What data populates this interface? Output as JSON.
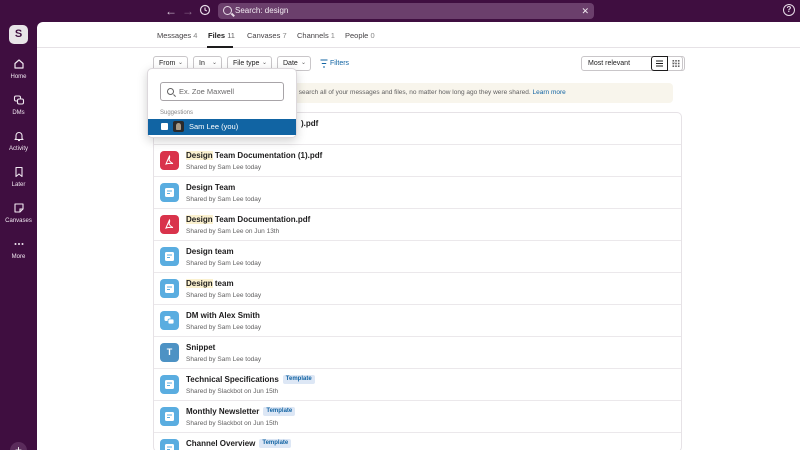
{
  "search": {
    "query": "Search: design"
  },
  "workspace": {
    "initial": "S"
  },
  "sidebar": {
    "items": [
      {
        "label": "Home",
        "icon": "home-icon"
      },
      {
        "label": "DMs",
        "icon": "dms-icon"
      },
      {
        "label": "Activity",
        "icon": "bell-icon"
      },
      {
        "label": "Later",
        "icon": "bookmark-icon"
      },
      {
        "label": "Canvases",
        "icon": "canvas-icon"
      },
      {
        "label": "More",
        "icon": "more-icon"
      }
    ]
  },
  "tabs": [
    {
      "label": "Messages",
      "count": "4"
    },
    {
      "label": "Files",
      "count": "11"
    },
    {
      "label": "Canvases",
      "count": "7"
    },
    {
      "label": "Channels",
      "count": "1"
    },
    {
      "label": "People",
      "count": "0"
    }
  ],
  "filters": {
    "from": "From",
    "in": "In",
    "file_type": "File type",
    "date": "Date",
    "more": "Filters",
    "sort": "Most relevant"
  },
  "banner": {
    "text": "now search all of your messages and files, no matter how long ago they were shared.",
    "link": "Learn more"
  },
  "dropdown": {
    "placeholder": "Ex. Zoe Maxwell",
    "suggestions_label": "Suggestions",
    "option": "Sam Lee (you)"
  },
  "results": [
    {
      "type": "pdf",
      "prefix": "",
      "title": ").pdf",
      "meta": "",
      "badge": ""
    },
    {
      "type": "pdf",
      "prefix": "Design",
      "title": " Team Documentation (1).pdf",
      "meta": "Shared by Sam Lee today",
      "badge": ""
    },
    {
      "type": "canvas",
      "prefix": "",
      "title": "Design Team",
      "meta": "Shared by Sam Lee today",
      "badge": ""
    },
    {
      "type": "pdf",
      "prefix": "Design",
      "title": " Team Documentation.pdf",
      "meta": "Shared by Sam Lee on Jun 13th",
      "badge": ""
    },
    {
      "type": "canvas",
      "prefix": "",
      "title": "Design team",
      "meta": "Shared by Sam Lee today",
      "badge": ""
    },
    {
      "type": "canvas",
      "prefix": "Design",
      "title": " team",
      "meta": "Shared by Sam Lee today",
      "badge": ""
    },
    {
      "type": "canvas",
      "prefix": "",
      "title": "DM with Alex Smith",
      "meta": "Shared by Sam Lee today",
      "badge": ""
    },
    {
      "type": "snippet",
      "prefix": "",
      "title": "Snippet",
      "meta": "Shared by Sam Lee today",
      "badge": ""
    },
    {
      "type": "canvas",
      "prefix": "",
      "title": "Technical Specifications",
      "meta": "Shared by Slackbot on Jun 15th",
      "badge": "Template"
    },
    {
      "type": "canvas",
      "prefix": "",
      "title": "Monthly Newsletter",
      "meta": "Shared by Slackbot on Jun 15th",
      "badge": "Template"
    },
    {
      "type": "canvas",
      "prefix": "",
      "title": "Channel Overview",
      "meta": "",
      "badge": "Template"
    }
  ],
  "snippet_glyph": "T",
  "colors": {
    "aubergine": "#3f0e40",
    "selection": "#1164a3",
    "pdf": "#d9334b",
    "canvas": "#5aade0"
  }
}
